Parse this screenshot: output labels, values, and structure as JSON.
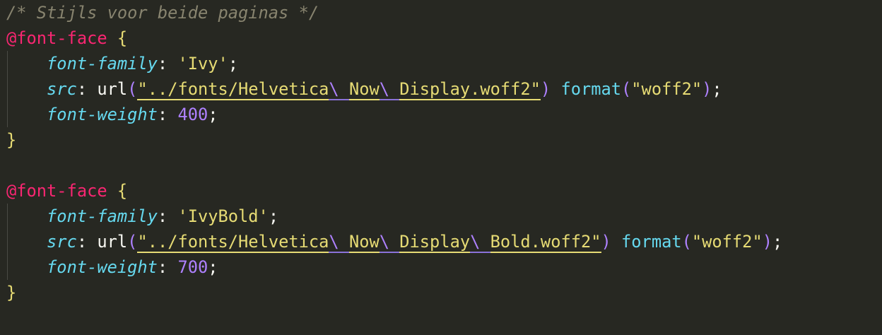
{
  "editor": {
    "comment": "/* Stijls voor beide paginas */",
    "blocks": [
      {
        "at_rule": "@font-face",
        "open_brace": "{",
        "close_brace": "}",
        "font_family_prop": "font-family",
        "font_family_value": "'Ivy'",
        "src_prop": "src",
        "src_url_func": "url",
        "src_url_parts": [
          "\"../fonts/Helvetica",
          "\\ ",
          "Now",
          "\\ ",
          "Display.woff2\""
        ],
        "format_func": "format",
        "format_value": "\"woff2\"",
        "font_weight_prop": "font-weight",
        "font_weight_value": "400"
      },
      {
        "at_rule": "@font-face",
        "open_brace": "{",
        "close_brace": "}",
        "font_family_prop": "font-family",
        "font_family_value": "'IvyBold'",
        "src_prop": "src",
        "src_url_func": "url",
        "src_url_parts": [
          "\"../fonts/Helvetica",
          "\\ ",
          "Now",
          "\\ ",
          "Display",
          "\\ ",
          "Bold.woff2\""
        ],
        "format_func": "format",
        "format_value": "\"woff2\"",
        "font_weight_prop": "font-weight",
        "font_weight_value": "700"
      }
    ],
    "partial_line": "@font-face {"
  },
  "colors": {
    "background": "#272822",
    "comment": "#88846f",
    "at_rule": "#f92672",
    "brace": "#e6db74",
    "property": "#66d9ef",
    "string": "#e6db74",
    "number": "#ae81ff",
    "escape": "#ae81ff"
  }
}
